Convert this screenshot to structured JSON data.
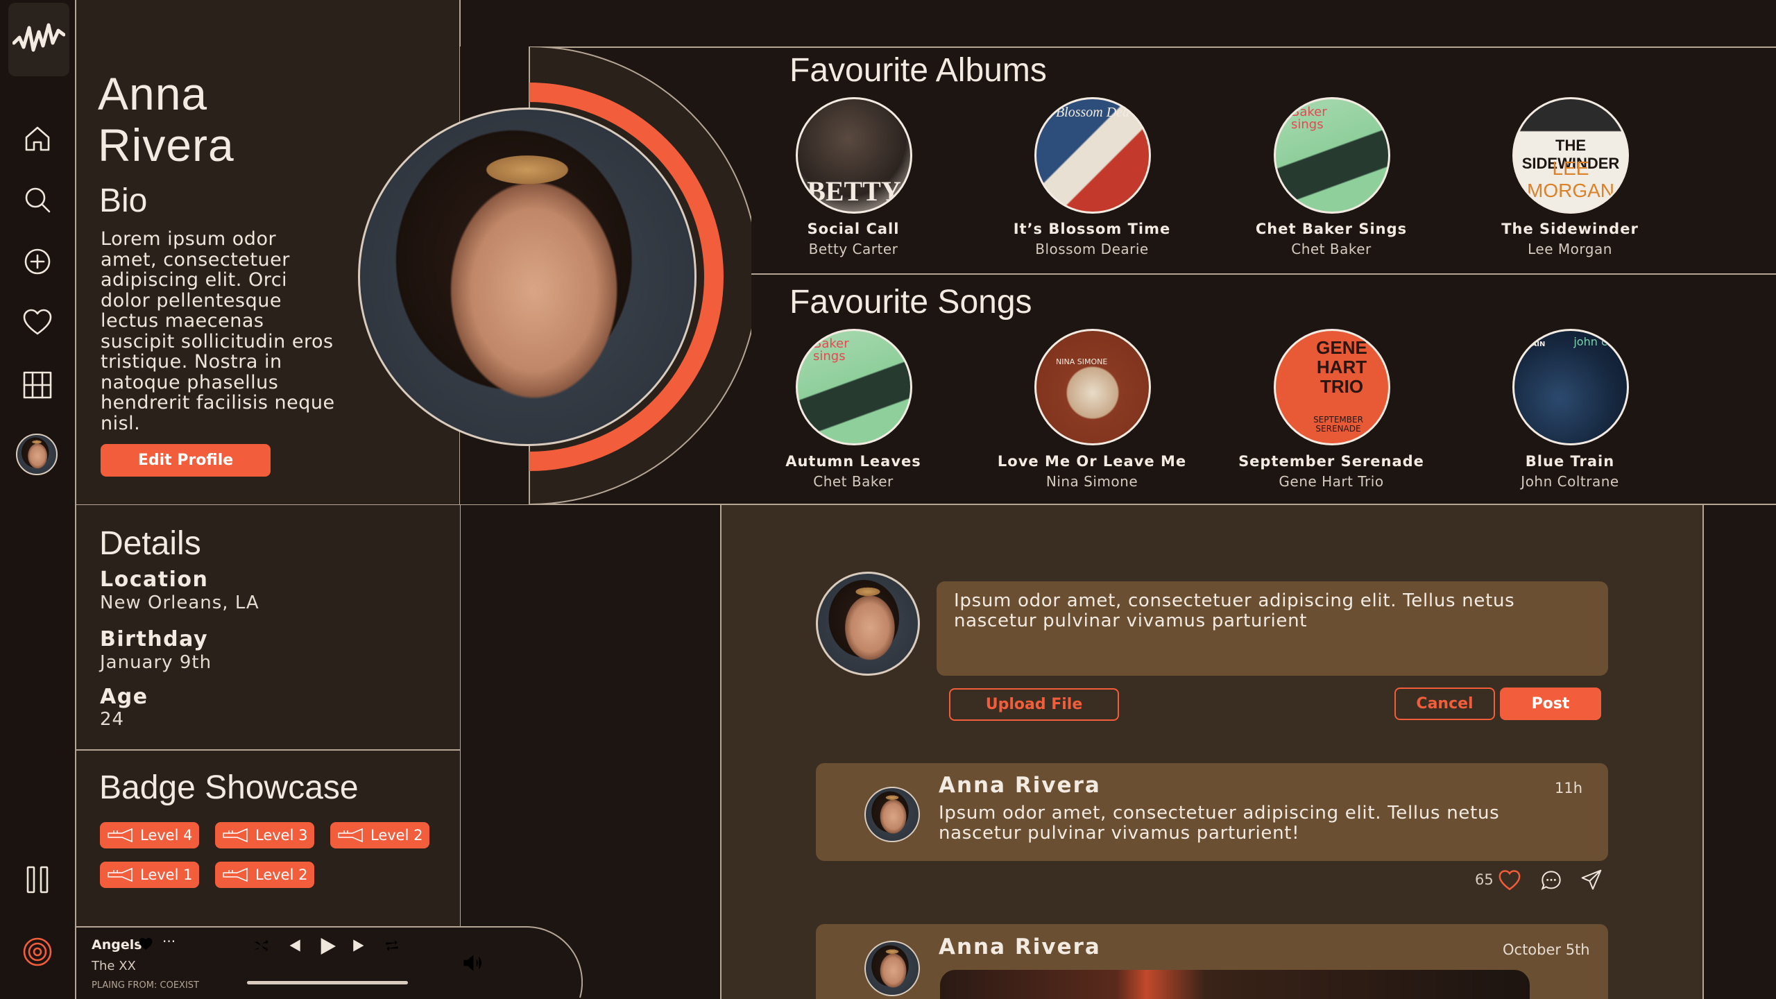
{
  "profile": {
    "first_name": "Anna",
    "last_name": "Rivera",
    "bio_heading": "Bio",
    "bio": "Lorem ipsum odor amet, consectetuer adipiscing elit. Orci dolor pellentesque lectus maecenas suscipit sollicitudin eros tristique. Nostra in natoque phasellus hendrerit facilisis neque nisl.",
    "edit_button": "Edit Profile"
  },
  "details": {
    "heading": "Details",
    "location_label": "Location",
    "location_value": "New Orleans, LA",
    "birthday_label": "Birthday",
    "birthday_value": "January 9th",
    "age_label": "Age",
    "age_value": "24"
  },
  "badges": {
    "heading": "Badge Showcase",
    "items": [
      "Level 4",
      "Level 3",
      "Level 2",
      "Level 1",
      "Level 2"
    ]
  },
  "albums": {
    "heading": "Favourite Albums",
    "items": [
      {
        "title": "Social Call",
        "artist": "Betty Carter",
        "cover_text": "BETTY"
      },
      {
        "title": "It’s Blossom Time",
        "artist": "Blossom Dearie",
        "cover_text": "Blossom Dea"
      },
      {
        "title": "Chet Baker Sings",
        "artist": "Chet Baker",
        "cover_text": "Baker sings"
      },
      {
        "title": "The Sidewinder",
        "artist": "Lee Morgan",
        "cover_text": "THE SIDEWINDER",
        "cover_text_2": "LEE MORGAN"
      }
    ]
  },
  "songs": {
    "heading": "Favourite Songs",
    "items": [
      {
        "title": "Autumn Leaves",
        "artist": "Chet Baker",
        "cover_text": "Baker sings"
      },
      {
        "title": "Love Me Or Leave Me",
        "artist": "Nina Simone",
        "cover_text": "NINA SIMONE"
      },
      {
        "title": "September Serenade",
        "artist": "Gene Hart Trio",
        "cover_text": "GENE HART TRIO",
        "cover_text_2": "SEPTEMBER SERENADE"
      },
      {
        "title": "Blue Train",
        "artist": "John Coltrane",
        "cover_text": "john col",
        "cover_text_2": "TRAIN"
      }
    ]
  },
  "composer": {
    "text": "Ipsum odor amet, consectetuer adipiscing elit. Tellus netus nascetur pulvinar vivamus parturient",
    "upload_button": "Upload File",
    "cancel_button": "Cancel",
    "post_button": "Post"
  },
  "posts": [
    {
      "author": "Anna Rivera",
      "time": "11h",
      "text": "Ipsum odor amet, consectetuer adipiscing elit. Tellus netus nascetur pulvinar vivamus parturient!",
      "likes": "65"
    },
    {
      "author": "Anna Rivera",
      "time": "October 5th"
    }
  ],
  "player": {
    "track": "Angels",
    "artist": "The XX",
    "source": "PLAING FROM: COEXIST",
    "progress": 1.0
  },
  "colors": {
    "accent": "#f25d3b",
    "panel": "#2a211b",
    "background": "#1c1512",
    "card": "#6a4f33"
  },
  "icons": [
    "logo-waveform-icon",
    "home-icon",
    "search-icon",
    "add-circle-icon",
    "heart-icon",
    "library-icon",
    "avatar",
    "pause-icon",
    "vinyl-icon",
    "shuffle-icon",
    "previous-icon",
    "play-icon",
    "next-icon",
    "repeat-icon",
    "volume-icon",
    "queue-icon",
    "comment-icon",
    "share-icon",
    "trumpet-icon"
  ]
}
